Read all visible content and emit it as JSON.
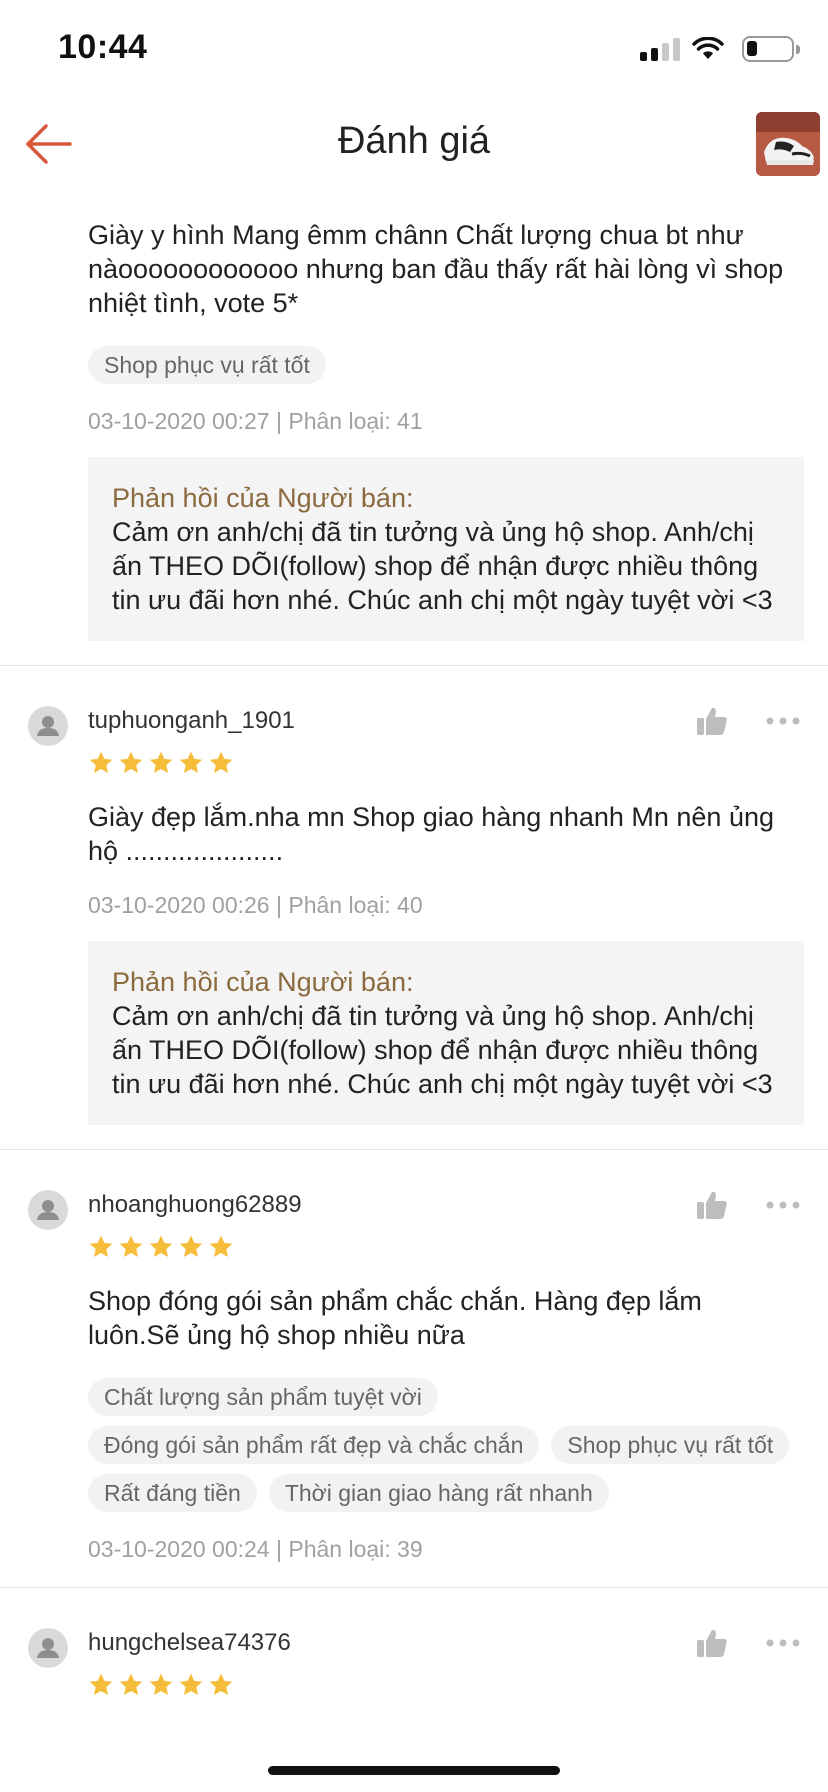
{
  "status_bar": {
    "time": "10:44",
    "icons": [
      "signal-icon",
      "wifi-icon",
      "battery-icon"
    ]
  },
  "nav": {
    "title": "Đánh giá",
    "back_icon": "arrow-left-icon",
    "accent_color": "#d9583b"
  },
  "reviews": [
    {
      "text": "Giày y hình Mang êmm chânn Chất lượng chua bt như nàoooooooooooo nhưng ban đầu thấy rất hài lòng vì shop nhiệt tình, vote 5*",
      "tags": [
        "Shop phục vụ rất tốt"
      ],
      "meta": "03-10-2020 00:27 | Phân loại: 41",
      "reply": {
        "label": "Phản hồi của Người bán:",
        "text": "Cảm ơn anh/chị đã tin tưởng và ủng hộ shop. Anh/chị ấn THEO DÕI(follow) shop để nhận được nhiều thông tin ưu đãi hơn nhé.  Chúc anh chị một ngày tuyệt vời <3"
      }
    },
    {
      "username": "tuphuonganh_1901",
      "rating": 5,
      "text": "Giày đẹp lắm.nha mn Shop giao hàng nhanh Mn nên ủng hộ .....................",
      "meta": "03-10-2020 00:26 | Phân loại: 40",
      "reply": {
        "label": "Phản hồi của Người bán:",
        "text": "Cảm ơn anh/chị đã tin tưởng và ủng hộ shop. Anh/chị ấn THEO DÕI(follow) shop để nhận được nhiều thông tin ưu đãi hơn nhé.  Chúc anh chị một ngày tuyệt vời <3"
      }
    },
    {
      "username": "nhoanghuong62889",
      "rating": 5,
      "text": "Shop đóng gói sản phẩm chắc chắn. Hàng đẹp lắm luôn.Sẽ ủng hộ shop nhiều nữa",
      "tags": [
        "Chất lượng sản phẩm tuyệt vời",
        "Đóng gói sản phẩm rất đẹp và chắc chắn",
        "Shop phục vụ rất tốt",
        "Rất đáng tiền",
        "Thời gian giao hàng rất nhanh"
      ],
      "meta": "03-10-2020 00:24 | Phân loại: 39"
    },
    {
      "username": "hungchelsea74376",
      "rating": 5
    }
  ]
}
